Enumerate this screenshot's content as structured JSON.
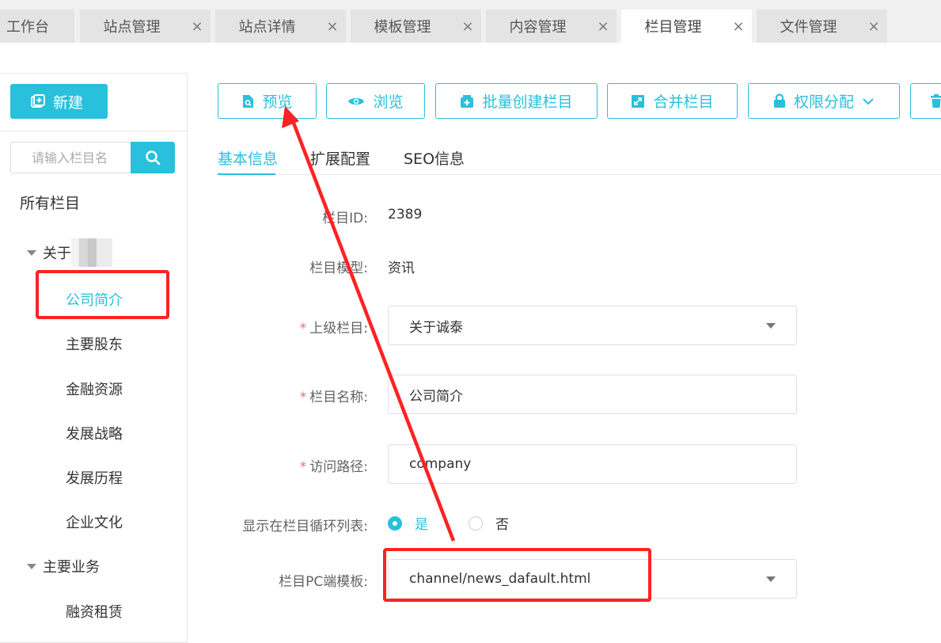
{
  "tabs": [
    {
      "label": "工作台",
      "active": false,
      "closable": false
    },
    {
      "label": "站点管理",
      "active": false,
      "closable": true
    },
    {
      "label": "站点详情",
      "active": false,
      "closable": true
    },
    {
      "label": "模板管理",
      "active": false,
      "closable": true
    },
    {
      "label": "内容管理",
      "active": false,
      "closable": true
    },
    {
      "label": "栏目管理",
      "active": true,
      "closable": true
    },
    {
      "label": "文件管理",
      "active": false,
      "closable": true
    }
  ],
  "close_glyph": "×",
  "accent_color": "#29c0dc",
  "annotation_color": "#ff2222",
  "sidebar": {
    "new_label": "新建",
    "search_placeholder": "请输入栏目名",
    "root_label": "所有栏目",
    "group1_label": "关于",
    "group1_children": [
      "公司简介",
      "主要股东",
      "金融资源",
      "发展战略",
      "发展历程",
      "企业文化"
    ],
    "group2_label": "主要业务",
    "group2_children": [
      "融资租赁"
    ]
  },
  "toolbar": {
    "preview_label": "预览",
    "browse_label": "浏览",
    "batch_create_label": "批量创建栏目",
    "merge_label": "合并栏目",
    "permission_label": "权限分配"
  },
  "subtabs": [
    "基本信息",
    "扩展配置",
    "SEO信息"
  ],
  "form": {
    "id_label": "栏目ID:",
    "id_value": "2389",
    "model_label": "栏目模型:",
    "model_value": "资讯",
    "parent_label": "上级栏目:",
    "parent_value": "关于诚泰",
    "name_label": "栏目名称:",
    "name_value": "公司简介",
    "path_label": "访问路径:",
    "path_value": "company",
    "show_label": "显示在栏目循环列表:",
    "show_yes": "是",
    "show_no": "否",
    "template_label": "栏目PC端模板:",
    "template_value": "channel/news_dafault.html"
  }
}
